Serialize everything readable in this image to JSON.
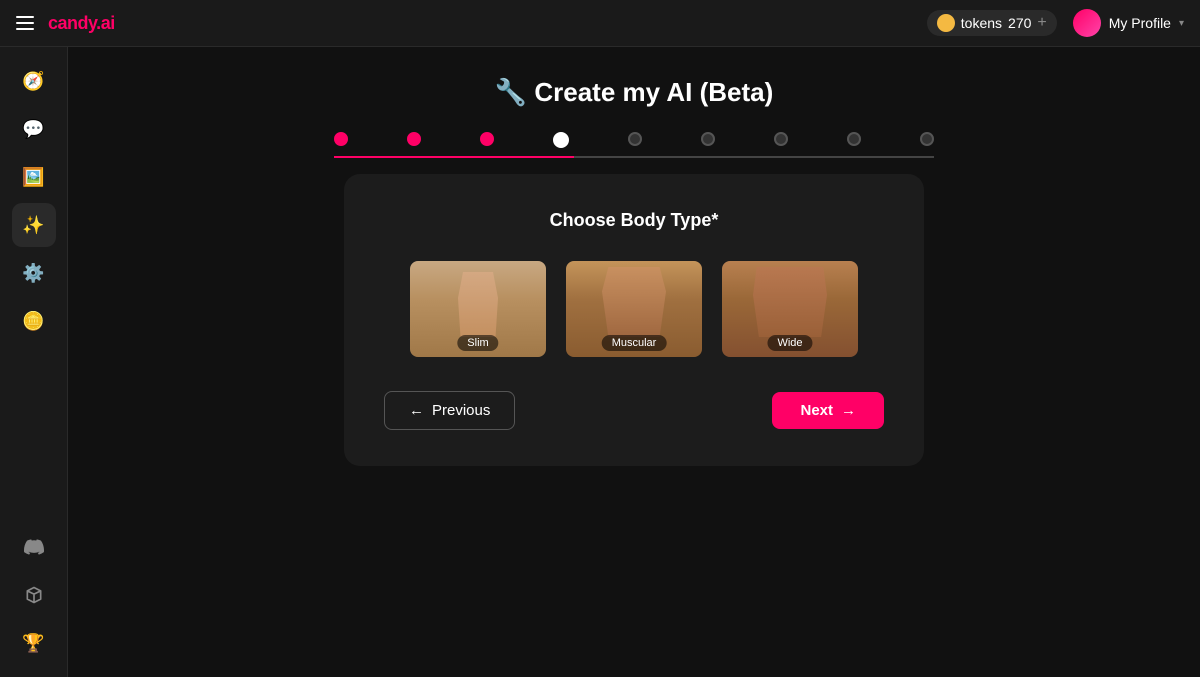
{
  "app": {
    "logo": "candy.ai",
    "logo_dot": ".",
    "hamburger_label": "menu"
  },
  "topnav": {
    "tokens_label": "tokens",
    "tokens_count": "270",
    "add_label": "+",
    "profile_label": "My Profile"
  },
  "sidebar": {
    "items": [
      {
        "id": "compass",
        "icon": "🧭",
        "label": "Discover"
      },
      {
        "id": "chat",
        "icon": "💬",
        "label": "Chat"
      },
      {
        "id": "photo",
        "icon": "🖼️",
        "label": "Photos"
      },
      {
        "id": "create",
        "icon": "✨",
        "label": "Create AI",
        "active": true
      },
      {
        "id": "github",
        "icon": "⚙️",
        "label": "Settings"
      },
      {
        "id": "coin",
        "icon": "🪙",
        "label": "Tokens"
      }
    ],
    "bottom_items": [
      {
        "id": "discord",
        "icon": "💬",
        "label": "Discord"
      },
      {
        "id": "gift",
        "icon": "🎁",
        "label": "Referral"
      },
      {
        "id": "trophy",
        "icon": "🏆",
        "label": "Leaderboard"
      }
    ]
  },
  "page": {
    "title": "🔧 Create my AI (Beta)",
    "step_current": 4,
    "step_total": 9,
    "progress_percent": 33
  },
  "progress": {
    "dots": [
      {
        "state": "completed"
      },
      {
        "state": "completed"
      },
      {
        "state": "completed"
      },
      {
        "state": "current"
      },
      {
        "state": "future"
      },
      {
        "state": "future"
      },
      {
        "state": "future"
      },
      {
        "state": "future"
      },
      {
        "state": "future"
      }
    ]
  },
  "card": {
    "title": "Choose Body Type*",
    "options": [
      {
        "id": "slim",
        "label": "Slim"
      },
      {
        "id": "muscular",
        "label": "Muscular"
      },
      {
        "id": "wide",
        "label": "Wide"
      }
    ],
    "btn_previous": "← Previous",
    "btn_next": "Next →"
  }
}
